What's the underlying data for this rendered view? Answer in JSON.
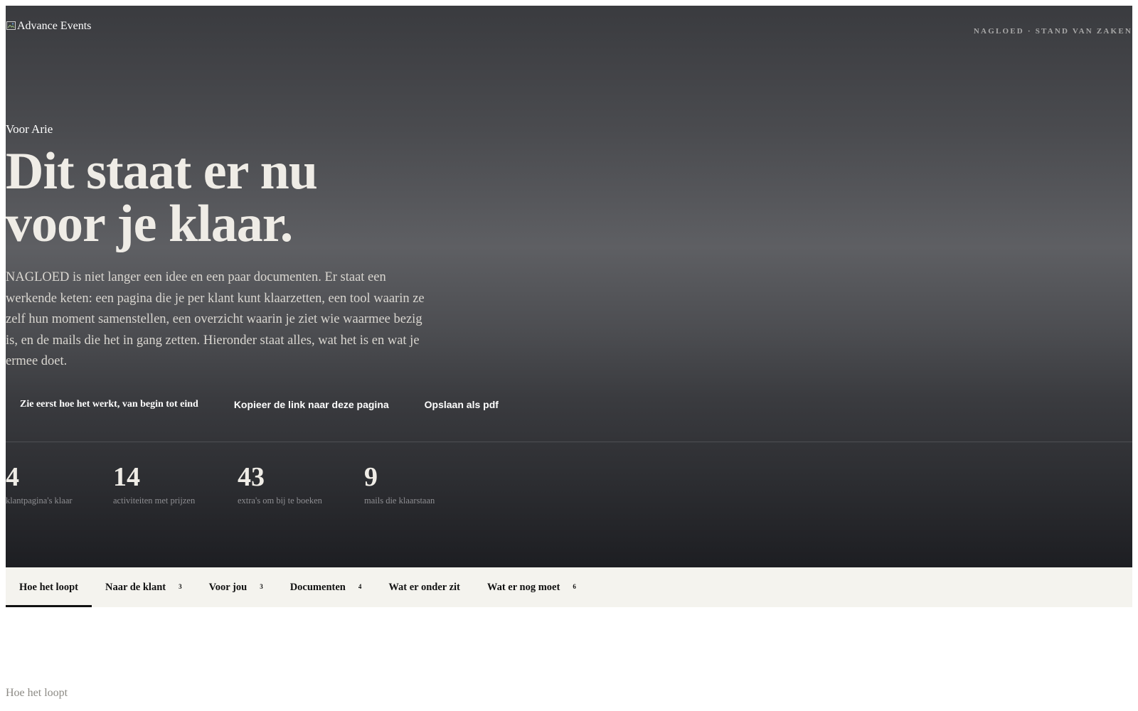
{
  "header": {
    "logo_alt": "Advance Events",
    "kicker": "NAGLOED · STAND VAN ZAKEN"
  },
  "hero": {
    "salutation": "Voor Arie",
    "headline_line1": "Dit staat er nu",
    "headline_line2": "voor je klaar.",
    "intro": "NAGLOED is niet langer een idee en een paar documenten. Er staat een werkende keten: een pagina die je per klant kunt klaarzetten, een tool waarin ze zelf hun moment samenstellen, een overzicht waarin je ziet wie waarmee bezig is, en de mails die het in gang zetten. Hieronder staat alles, wat het is en wat je ermee doet."
  },
  "actions": {
    "primary": "Zie eerst hoe het werkt, van begin tot eind",
    "copy_link": "Kopieer de link naar deze pagina",
    "save_pdf": "Opslaan als pdf"
  },
  "stats": [
    {
      "value": "4",
      "label": "klantpagina's klaar"
    },
    {
      "value": "14",
      "label": "activiteiten met prijzen"
    },
    {
      "value": "43",
      "label": "extra's om bij te boeken"
    },
    {
      "value": "9",
      "label": "mails die klaarstaan"
    }
  ],
  "tabs": [
    {
      "label": "Hoe het loopt",
      "count": "",
      "active": true
    },
    {
      "label": "Naar de klant",
      "count": "3"
    },
    {
      "label": "Voor jou",
      "count": "3"
    },
    {
      "label": "Documenten",
      "count": "4"
    },
    {
      "label": "Wat er onder zit",
      "count": ""
    },
    {
      "label": "Wat er nog moet",
      "count": "6"
    }
  ],
  "section": {
    "label": "Hoe het loopt"
  },
  "colors": {
    "hero_top": "#3a3b3f",
    "hero_mid": "#5e5f63",
    "hero_bottom": "#1d1e22",
    "tabbar_bg": "#f4f3ee",
    "headline": "#efece6",
    "muted": "#8e8e92"
  },
  "icons": {
    "logo": "broken-image-icon"
  }
}
